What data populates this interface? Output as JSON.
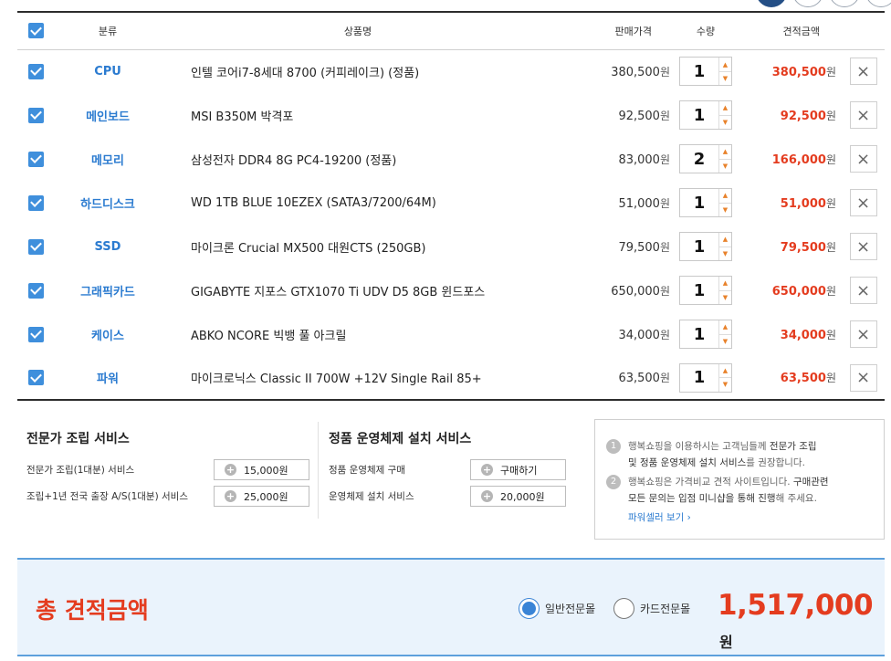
{
  "table": {
    "headers": {
      "category": "분류",
      "product": "상품명",
      "price": "판매가격",
      "quantity": "수량",
      "estimate": "견적금액"
    },
    "currency_unit": "원",
    "rows": [
      {
        "category": "CPU",
        "product": "인텔 코어i7-8세대 8700 (커피레이크) (정품)",
        "price": "380,500",
        "qty": "1",
        "total": "380,500"
      },
      {
        "category": "메인보드",
        "product": "MSI B350M 박격포",
        "price": "92,500",
        "qty": "1",
        "total": "92,500"
      },
      {
        "category": "메모리",
        "product": "삼성전자 DDR4 8G PC4-19200 (정품)",
        "price": "83,000",
        "qty": "2",
        "total": "166,000"
      },
      {
        "category": "하드디스크",
        "product": "WD 1TB BLUE 10EZEX (SATA3/7200/64M)",
        "price": "51,000",
        "qty": "1",
        "total": "51,000"
      },
      {
        "category": "SSD",
        "product": "마이크론 Crucial MX500 대원CTS (250GB)",
        "price": "79,500",
        "qty": "1",
        "total": "79,500"
      },
      {
        "category": "그래픽카드",
        "product": "GIGABYTE 지포스 GTX1070 Ti UDV D5 8GB 윈드포스",
        "price": "650,000",
        "qty": "1",
        "total": "650,000"
      },
      {
        "category": "케이스",
        "product": "ABKO NCORE 빅뱅 풀 아크릴",
        "price": "34,000",
        "qty": "1",
        "total": "34,000"
      },
      {
        "category": "파워",
        "product": "마이크로닉스 Classic II 700W +12V Single Rail 85+",
        "price": "63,500",
        "qty": "1",
        "total": "63,500"
      }
    ]
  },
  "expert_service": {
    "title": "전문가 조립 서비스",
    "rows": [
      {
        "label": "전문가 조립(1대분) 서비스",
        "button": "15,000원"
      },
      {
        "label": "조립+1년 전국 출장 A/S(1대분) 서비스",
        "button": "25,000원"
      }
    ]
  },
  "os_service": {
    "title": "정품 운영체제 설치 서비스",
    "rows": [
      {
        "label": "정품 운영체제 구매",
        "button": "구매하기"
      },
      {
        "label": "운영체제 설치 서비스",
        "button": "20,000원"
      }
    ]
  },
  "notice": {
    "item1_num": "1",
    "item1_line1_a": "행복쇼핑을 이용하시는 고객님들께 ",
    "item1_line1_b": "전문가 조립",
    "item1_line2_a": "및 정품 운영체제 설치 서비스",
    "item1_line2_b": "를 권장",
    "item1_line2_c": "합니다.",
    "item2_num": "2",
    "item2_line1_a": "행복쇼핑은 가격비교 견적 사이트입니다. ",
    "item2_line1_b": "구매관련",
    "item2_line2_a": "모든 문의는 입점 미니샵을 통해 진행",
    "item2_line2_b": "해 주세요.",
    "link": "파워셀러 보기 ›"
  },
  "total": {
    "label": "총 견적금액",
    "option_normal": "일반전문몰",
    "option_card": "카드전문몰",
    "selected": "일반전문몰",
    "amount": "1,517,000",
    "unit": "원"
  },
  "colors": {
    "accent_blue": "#2b7bd0",
    "price_red": "#e43c1f",
    "checkbox_blue": "#3f8fdc",
    "total_bg": "#eaf3fc"
  }
}
